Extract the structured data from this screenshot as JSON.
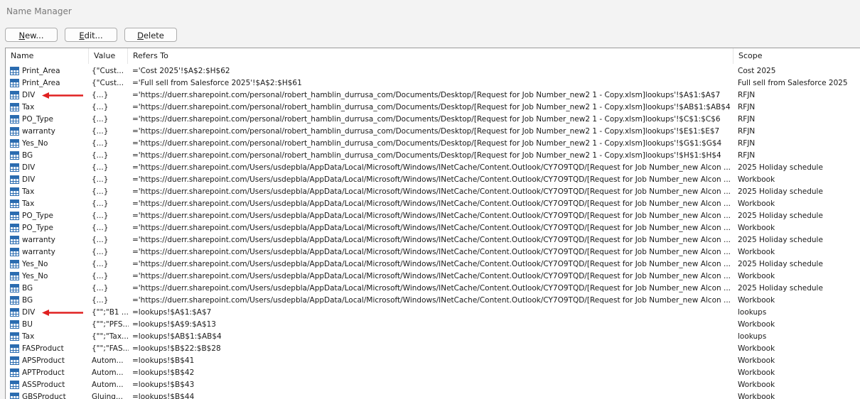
{
  "window": {
    "title": "Name Manager"
  },
  "toolbar": {
    "new": {
      "ul": "N",
      "rest": "ew..."
    },
    "edit": {
      "ul": "E",
      "rest": "dit..."
    },
    "delete": {
      "ul": "D",
      "rest": "elete"
    }
  },
  "columns": {
    "name": "Name",
    "value": "Value",
    "refers": "Refers To",
    "scope": "Scope"
  },
  "colors": {
    "arrow": "#e02020",
    "icon": "#2b6cb0"
  },
  "rows": [
    {
      "name": "Print_Area",
      "value": "{\"Cust...",
      "refers": "='Cost 2025'!$A$2:$H$62",
      "scope": "Cost 2025",
      "arrow": false
    },
    {
      "name": "Print_Area",
      "value": "{\"Cust...",
      "refers": "='Full sell from Salesforce 2025'!$A$2:$H$61",
      "scope": "Full sell from Salesforce 2025",
      "arrow": false
    },
    {
      "name": "DIV",
      "value": "{...}",
      "refers": "='https://duerr.sharepoint.com/personal/robert_hamblin_durrusa_com/Documents/Desktop/[Request for Job Number_new2 1 - Copy.xlsm]lookups'!$A$1:$A$7",
      "scope": "RFJN",
      "arrow": true
    },
    {
      "name": "Tax",
      "value": "{...}",
      "refers": "='https://duerr.sharepoint.com/personal/robert_hamblin_durrusa_com/Documents/Desktop/[Request for Job Number_new2 1 - Copy.xlsm]lookups'!$AB$1:$AB$4",
      "scope": "RFJN",
      "arrow": false
    },
    {
      "name": "PO_Type",
      "value": "{...}",
      "refers": "='https://duerr.sharepoint.com/personal/robert_hamblin_durrusa_com/Documents/Desktop/[Request for Job Number_new2 1 - Copy.xlsm]lookups'!$C$1:$C$6",
      "scope": "RFJN",
      "arrow": false
    },
    {
      "name": "warranty",
      "value": "{...}",
      "refers": "='https://duerr.sharepoint.com/personal/robert_hamblin_durrusa_com/Documents/Desktop/[Request for Job Number_new2 1 - Copy.xlsm]lookups'!$E$1:$E$7",
      "scope": "RFJN",
      "arrow": false
    },
    {
      "name": "Yes_No",
      "value": "{...}",
      "refers": "='https://duerr.sharepoint.com/personal/robert_hamblin_durrusa_com/Documents/Desktop/[Request for Job Number_new2 1 - Copy.xlsm]lookups'!$G$1:$G$4",
      "scope": "RFJN",
      "arrow": false
    },
    {
      "name": "BG",
      "value": "{...}",
      "refers": "='https://duerr.sharepoint.com/personal/robert_hamblin_durrusa_com/Documents/Desktop/[Request for Job Number_new2 1 - Copy.xlsm]lookups'!$H$1:$H$4",
      "scope": "RFJN",
      "arrow": false
    },
    {
      "name": "DIV",
      "value": "{...}",
      "refers": "='https://duerr.sharepoint.com/Users/usdepbla/AppData/Local/Microsoft/Windows/INetCache/Content.Outlook/CY7O9TQD/[Request for Job Number_new Alcon ...",
      "scope": "2025 Holiday schedule",
      "arrow": false
    },
    {
      "name": "DIV",
      "value": "{...}",
      "refers": "='https://duerr.sharepoint.com/Users/usdepbla/AppData/Local/Microsoft/Windows/INetCache/Content.Outlook/CY7O9TQD/[Request for Job Number_new Alcon ...",
      "scope": "Workbook",
      "arrow": false
    },
    {
      "name": "Tax",
      "value": "{...}",
      "refers": "='https://duerr.sharepoint.com/Users/usdepbla/AppData/Local/Microsoft/Windows/INetCache/Content.Outlook/CY7O9TQD/[Request for Job Number_new Alcon ...",
      "scope": "2025 Holiday schedule",
      "arrow": false
    },
    {
      "name": "Tax",
      "value": "{...}",
      "refers": "='https://duerr.sharepoint.com/Users/usdepbla/AppData/Local/Microsoft/Windows/INetCache/Content.Outlook/CY7O9TQD/[Request for Job Number_new Alcon ...",
      "scope": "Workbook",
      "arrow": false
    },
    {
      "name": "PO_Type",
      "value": "{...}",
      "refers": "='https://duerr.sharepoint.com/Users/usdepbla/AppData/Local/Microsoft/Windows/INetCache/Content.Outlook/CY7O9TQD/[Request for Job Number_new Alcon ...",
      "scope": "2025 Holiday schedule",
      "arrow": false
    },
    {
      "name": "PO_Type",
      "value": "{...}",
      "refers": "='https://duerr.sharepoint.com/Users/usdepbla/AppData/Local/Microsoft/Windows/INetCache/Content.Outlook/CY7O9TQD/[Request for Job Number_new Alcon ...",
      "scope": "Workbook",
      "arrow": false
    },
    {
      "name": "warranty",
      "value": "{...}",
      "refers": "='https://duerr.sharepoint.com/Users/usdepbla/AppData/Local/Microsoft/Windows/INetCache/Content.Outlook/CY7O9TQD/[Request for Job Number_new Alcon ...",
      "scope": "2025 Holiday schedule",
      "arrow": false
    },
    {
      "name": "warranty",
      "value": "{...}",
      "refers": "='https://duerr.sharepoint.com/Users/usdepbla/AppData/Local/Microsoft/Windows/INetCache/Content.Outlook/CY7O9TQD/[Request for Job Number_new Alcon ...",
      "scope": "Workbook",
      "arrow": false
    },
    {
      "name": "Yes_No",
      "value": "{...}",
      "refers": "='https://duerr.sharepoint.com/Users/usdepbla/AppData/Local/Microsoft/Windows/INetCache/Content.Outlook/CY7O9TQD/[Request for Job Number_new Alcon ...",
      "scope": "2025 Holiday schedule",
      "arrow": false
    },
    {
      "name": "Yes_No",
      "value": "{...}",
      "refers": "='https://duerr.sharepoint.com/Users/usdepbla/AppData/Local/Microsoft/Windows/INetCache/Content.Outlook/CY7O9TQD/[Request for Job Number_new Alcon ...",
      "scope": "Workbook",
      "arrow": false
    },
    {
      "name": "BG",
      "value": "{...}",
      "refers": "='https://duerr.sharepoint.com/Users/usdepbla/AppData/Local/Microsoft/Windows/INetCache/Content.Outlook/CY7O9TQD/[Request for Job Number_new Alcon ...",
      "scope": "2025 Holiday schedule",
      "arrow": false
    },
    {
      "name": "BG",
      "value": "{...}",
      "refers": "='https://duerr.sharepoint.com/Users/usdepbla/AppData/Local/Microsoft/Windows/INetCache/Content.Outlook/CY7O9TQD/[Request for Job Number_new Alcon ...",
      "scope": "Workbook",
      "arrow": false
    },
    {
      "name": "DIV",
      "value": "{\"\";\"B1 ...",
      "refers": "=lookups!$A$1:$A$7",
      "scope": "lookups",
      "arrow": true
    },
    {
      "name": "BU",
      "value": "{\"\";\"PFS...",
      "refers": "=lookups!$A$9:$A$13",
      "scope": "Workbook",
      "arrow": false
    },
    {
      "name": "Tax",
      "value": "{\"\";\"Tax...",
      "refers": "=lookups!$AB$1:$AB$4",
      "scope": "lookups",
      "arrow": false
    },
    {
      "name": "FASProduct",
      "value": "{\"\";\"FAS...",
      "refers": "=lookups!$B$22:$B$28",
      "scope": "Workbook",
      "arrow": false
    },
    {
      "name": "APSProduct",
      "value": "Autom...",
      "refers": "=lookups!$B$41",
      "scope": "Workbook",
      "arrow": false
    },
    {
      "name": "APTProduct",
      "value": "Autom...",
      "refers": "=lookups!$B$42",
      "scope": "Workbook",
      "arrow": false
    },
    {
      "name": "ASSProduct",
      "value": "Autom...",
      "refers": "=lookups!$B$43",
      "scope": "Workbook",
      "arrow": false
    },
    {
      "name": "GBSProduct",
      "value": "Gluing...",
      "refers": "=lookups!$B$44",
      "scope": "Workbook",
      "arrow": false
    }
  ]
}
